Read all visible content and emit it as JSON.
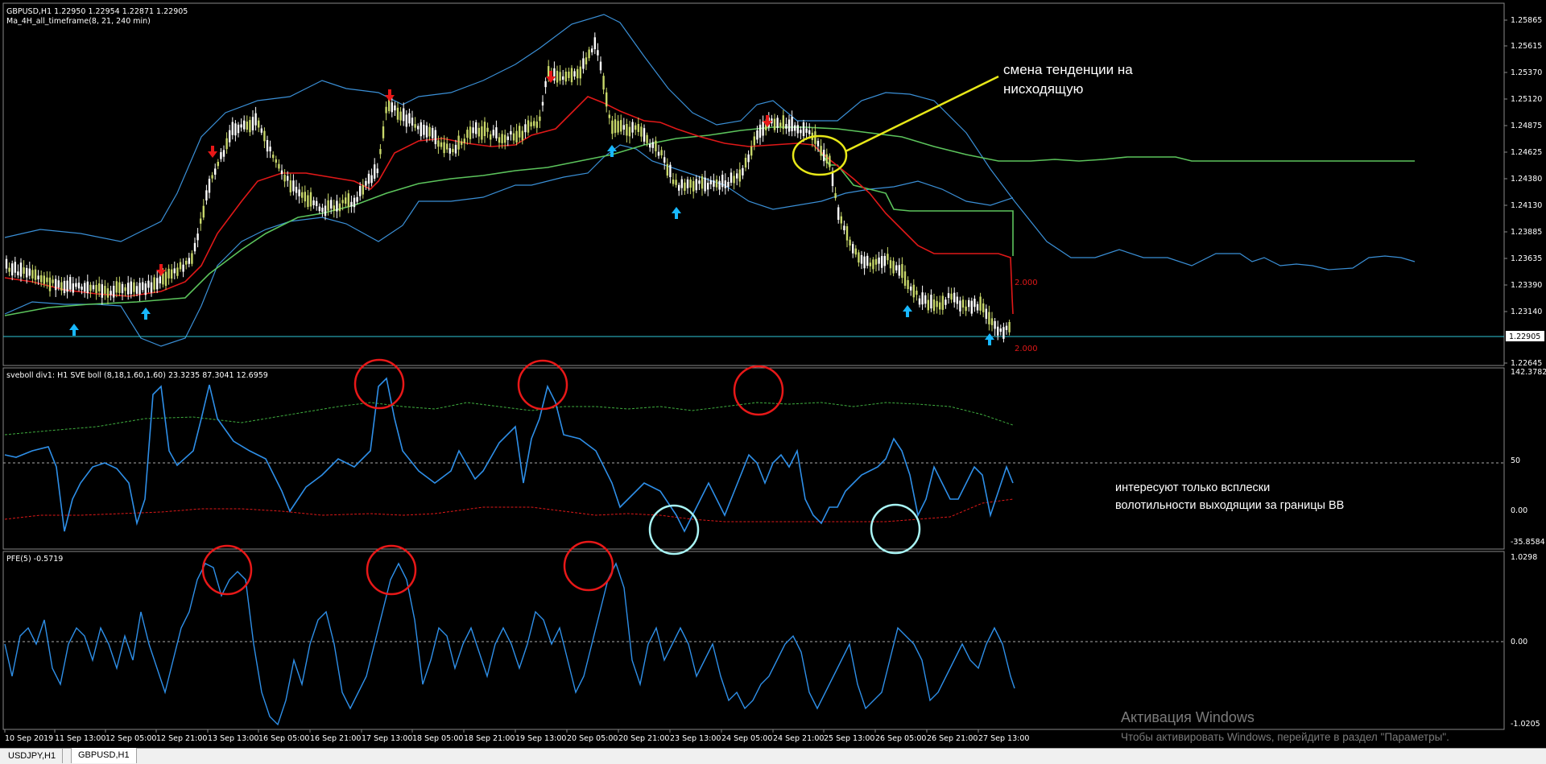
{
  "main": {
    "title": "GBPUSD,H1  1.22950 1.22954 1.22871 1.22905",
    "indicator": "Ma_4H_all_timeframe(8, 21, 240 min)",
    "price_labels": [
      "1.25865",
      "1.25615",
      "1.25370",
      "1.25120",
      "1.24875",
      "1.24625",
      "1.24380",
      "1.24130",
      "1.23885",
      "1.23635",
      "1.23390",
      "1.23140",
      "1.22905",
      "1.22645"
    ],
    "current_price": "1.22905",
    "line_marks": [
      "2.000",
      "2.000"
    ],
    "annotation": [
      "смена тенденции на",
      "нисходящую"
    ]
  },
  "sub1": {
    "title": "sveboll div1: H1 SVE boll (8,18,1.60,1.60) 23.3235 87.3041 12.6959",
    "scale": [
      "142.3782",
      "50",
      "0.00",
      "-35.8584"
    ],
    "annotation": [
      "интересуют только всплески",
      "волотильности выходящии за границы ВВ"
    ]
  },
  "sub2": {
    "title": "PFE(5) -0.5719",
    "scale": [
      "1.0298",
      "0.00",
      "-1.0205"
    ]
  },
  "time_labels": [
    "10 Sep 2019",
    "11 Sep 13:00",
    "12 Sep 05:00",
    "12 Sep 21:00",
    "13 Sep 13:00",
    "16 Sep 05:00",
    "16 Sep 21:00",
    "17 Sep 13:00",
    "18 Sep 05:00",
    "18 Sep 21:00",
    "19 Sep 13:00",
    "20 Sep 05:00",
    "20 Sep 21:00",
    "23 Sep 13:00",
    "24 Sep 05:00",
    "24 Sep 21:00",
    "25 Sep 13:00",
    "26 Sep 05:00",
    "26 Sep 21:00",
    "27 Sep 13:00"
  ],
  "watermark": [
    "Активация Windows",
    "Чтобы активировать Windows, перейдите в раздел \"Параметры\"."
  ],
  "tabs": [
    "USDJPY,H1",
    "GBPUSD,H1"
  ],
  "colors": {
    "bull": "#c8d86a",
    "bear": "#ffffff",
    "band": "#3a8fd6",
    "ma_fast": "#e01818",
    "ma_slow": "#5cc45c",
    "osc": "#2e8fe8",
    "arrow_up": "#18b8ff",
    "arrow_down": "#e81818"
  }
}
